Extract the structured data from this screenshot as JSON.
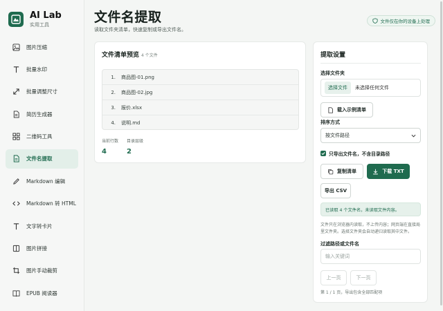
{
  "brand": {
    "title": "AI Lab",
    "subtitle": "实用工具"
  },
  "sidebar": {
    "items": [
      {
        "label": "图片压缩",
        "icon": "image-icon"
      },
      {
        "label": "批量水印",
        "icon": "text-t-icon"
      },
      {
        "label": "批量调整尺寸",
        "icon": "resize-icon"
      },
      {
        "label": "简历生成器",
        "icon": "document-icon"
      },
      {
        "label": "二维码工具",
        "icon": "grid-icon"
      },
      {
        "label": "文件名提取",
        "icon": "file-icon",
        "active": true
      },
      {
        "label": "Markdown 编辑",
        "icon": "pen-icon"
      },
      {
        "label": "Markdown 转 HTML",
        "icon": "code-icon"
      },
      {
        "label": "文字转卡片",
        "icon": "text-t-icon"
      },
      {
        "label": "图片拼接",
        "icon": "book-open-icon"
      },
      {
        "label": "图片手动裁剪",
        "icon": "crop-icon"
      },
      {
        "label": "EPUB 阅读器",
        "icon": "book-icon"
      }
    ]
  },
  "header": {
    "title": "文件名提取",
    "description": "读取文件夹清单，快速复制或导出文件名。",
    "privacy_badge": "文件仅在你的设备上处理"
  },
  "preview": {
    "title": "文件清单预览",
    "count_tag": "4 个文件",
    "files": [
      {
        "index": "1.",
        "name": "商品图-01.png"
      },
      {
        "index": "2.",
        "name": "商品图-02.jpg"
      },
      {
        "index": "3.",
        "name": "报价.xlsx"
      },
      {
        "index": "4.",
        "name": "说明.md"
      }
    ],
    "stats": [
      {
        "label": "当前行数",
        "value": "4"
      },
      {
        "label": "目录层级",
        "value": "2"
      }
    ]
  },
  "settings": {
    "title": "提取设置",
    "folder_label": "选择文件夹",
    "choose_file_button": "选择文件",
    "no_file_text": "未选择任何文件",
    "load_sample_button": "载入示例清单",
    "sort_label": "排序方式",
    "sort_value": "按文件路径",
    "checkbox_label": "只导出文件名，不含目录路径",
    "copy_button": "复制清单",
    "download_button": "下载 TXT",
    "csv_button": "导出 CSV",
    "status_text": "已读取 4 个文件名，未读取文件内容。",
    "note": "文件只在浏览器内读取，不上传内容；网页端在直接局里文件夹。选择文件夹会自动递归读取其中文件。",
    "filter_label": "过滤路径或文件名",
    "filter_placeholder": "输入关键词",
    "prev_button": "上一页",
    "next_button": "下一页",
    "page_info": "第 1 / 1 页，导出包含全部匹配项"
  },
  "colors": {
    "accent": "#1f6b4f",
    "accent_light": "#e6f1eb"
  }
}
